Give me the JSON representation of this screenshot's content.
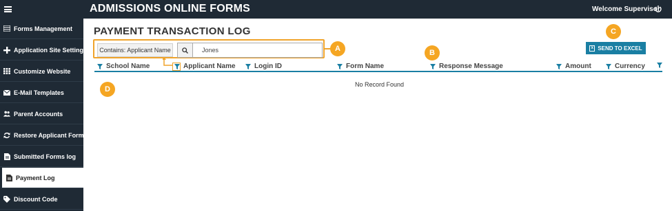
{
  "header": {
    "title": "ADMISSIONS ONLINE FORMS",
    "welcome": "Welcome Supervisor"
  },
  "sidebar": {
    "items": [
      {
        "label": "Forms Management",
        "icon": "list-icon"
      },
      {
        "label": "Application Site Settings",
        "icon": "plus-icon"
      },
      {
        "label": "Customize Website",
        "icon": "grid-icon"
      },
      {
        "label": "E-Mail Templates",
        "icon": "envelope-icon"
      },
      {
        "label": "Parent Accounts",
        "icon": "users-icon"
      },
      {
        "label": "Restore Applicant Forms",
        "icon": "refresh-icon"
      },
      {
        "label": "Submitted Forms log",
        "icon": "document-icon"
      },
      {
        "label": "Payment Log",
        "icon": "document-icon",
        "active": true
      },
      {
        "label": "Discount Code",
        "icon": "tag-icon"
      }
    ]
  },
  "main": {
    "page_title": "PAYMENT TRANSACTION LOG",
    "filter": {
      "contains_label": "Contains: Applicant Name",
      "search_value": "Jones"
    },
    "export_label": "SEND TO EXCEL",
    "columns": [
      "School Name",
      "Applicant Name",
      "Login ID",
      "Form Name",
      "Response Message",
      "Amount",
      "Currency"
    ],
    "empty_text": "No Record Found"
  },
  "callouts": {
    "a": "A",
    "b": "B",
    "c": "C",
    "d": "D"
  },
  "colors": {
    "sidebar": "#1f2a35",
    "accent": "#1a7fa3",
    "callout": "#f5a623"
  }
}
